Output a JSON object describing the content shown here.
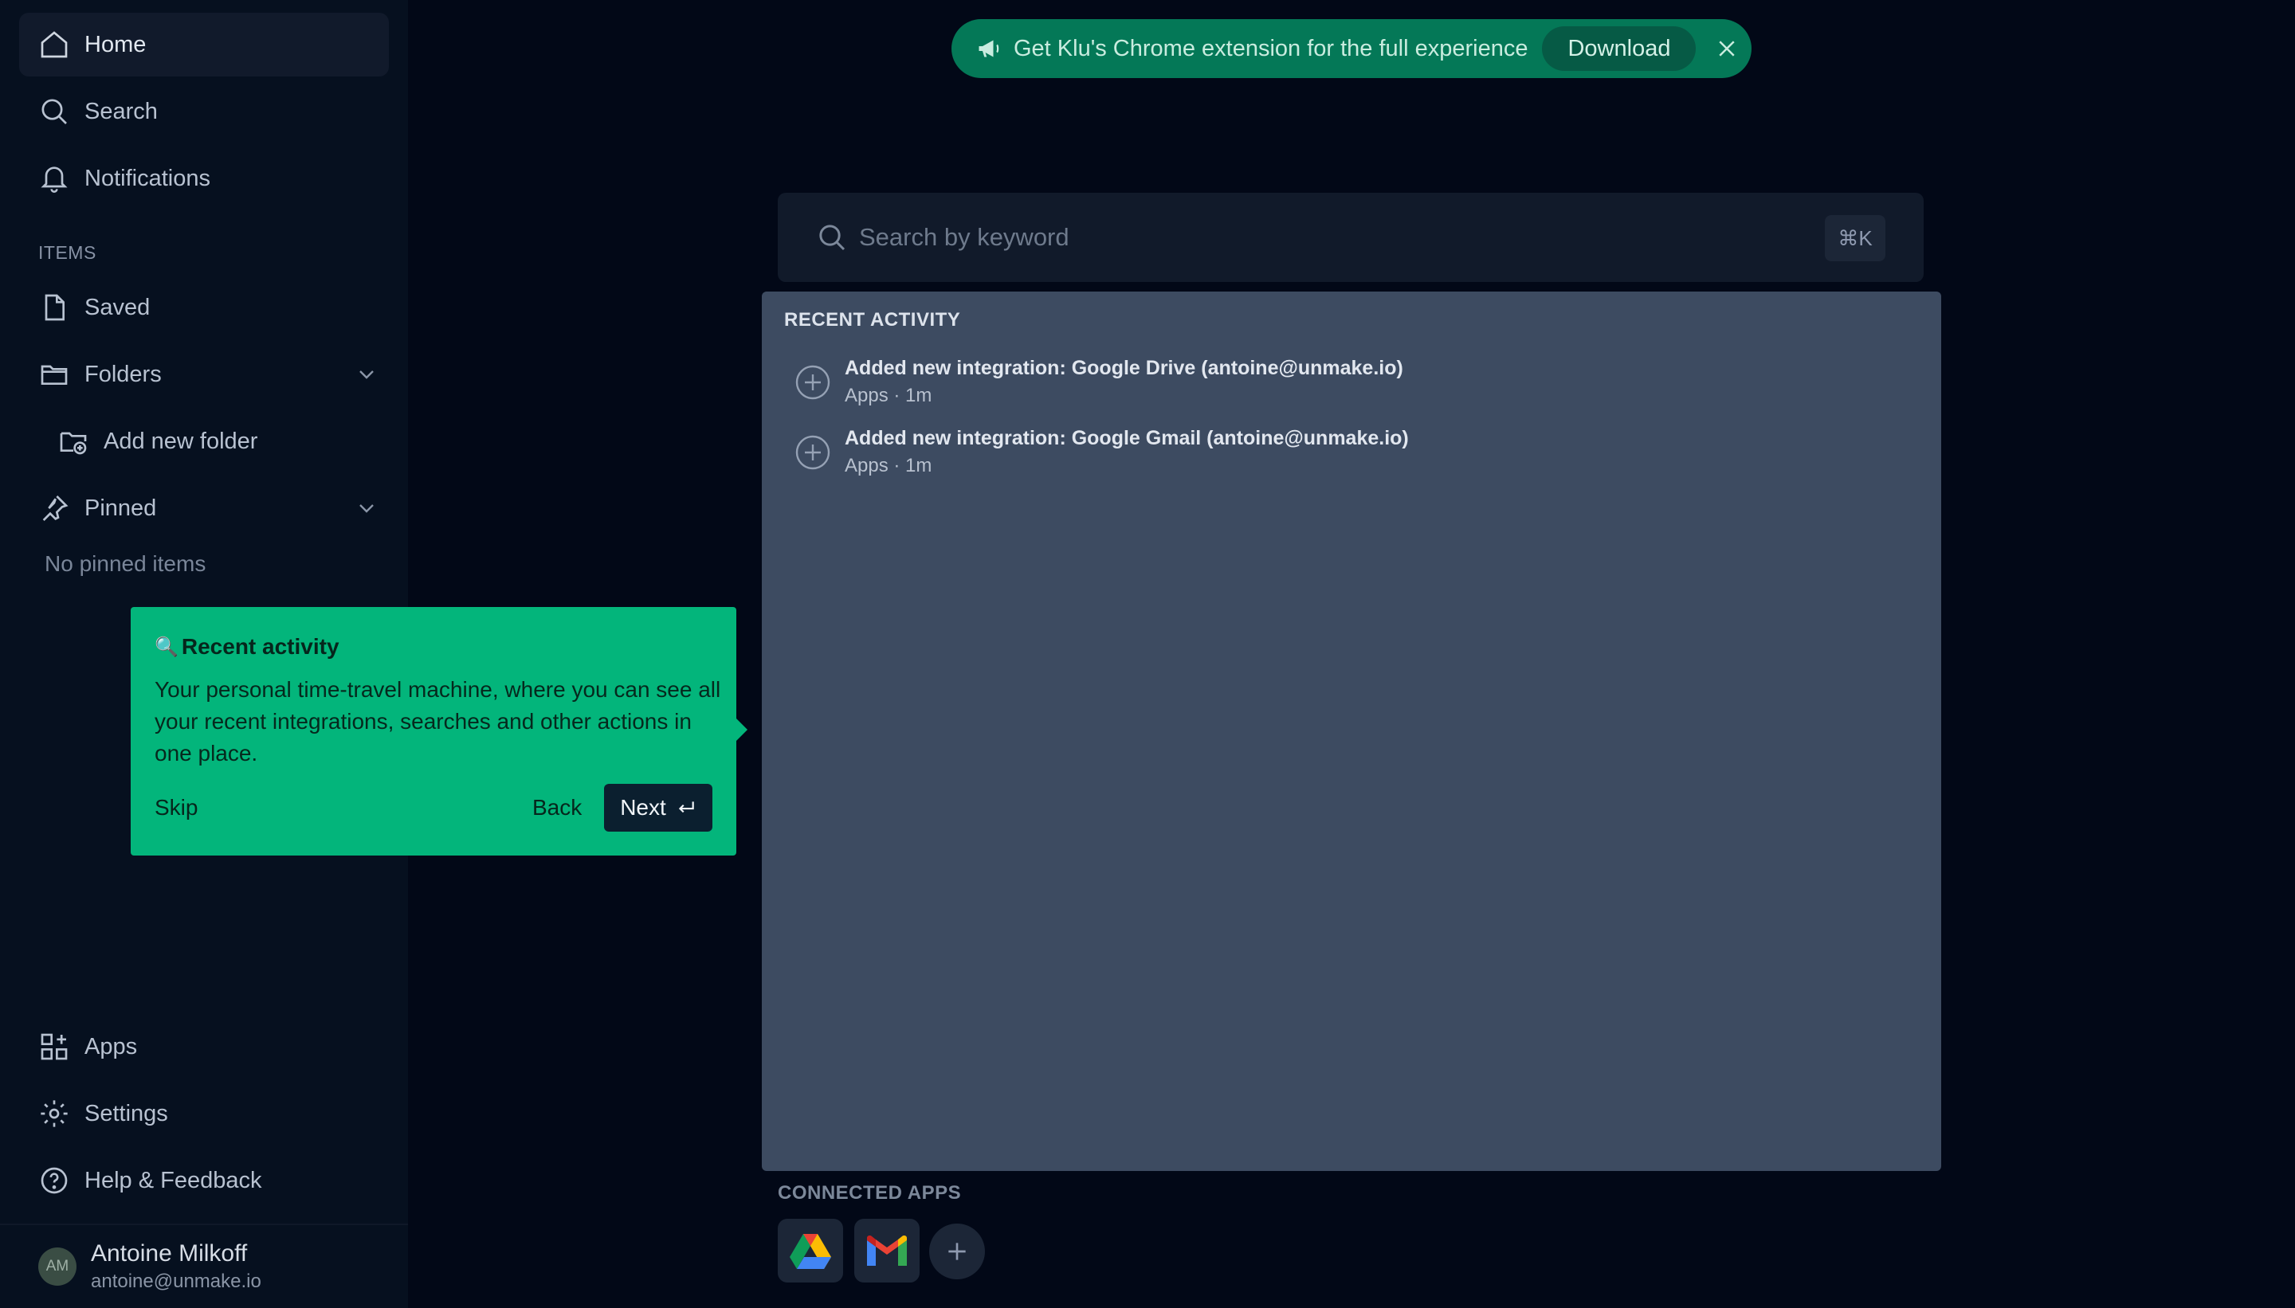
{
  "sidebar": {
    "nav": [
      {
        "label": "Home",
        "icon": "home-icon"
      },
      {
        "label": "Search",
        "icon": "search-icon"
      },
      {
        "label": "Notifications",
        "icon": "bell-icon"
      }
    ],
    "items_section": "ITEMS",
    "saved": "Saved",
    "folders": "Folders",
    "add_folder": "Add new folder",
    "pinned": "Pinned",
    "no_pinned": "No pinned items",
    "bottom": [
      {
        "label": "Apps",
        "icon": "apps-grid-icon"
      },
      {
        "label": "Settings",
        "icon": "gear-icon"
      },
      {
        "label": "Help & Feedback",
        "icon": "help-circle-icon"
      }
    ]
  },
  "user": {
    "initials": "AM",
    "name": "Antoine Milkoff",
    "email": "antoine@unmake.io"
  },
  "banner": {
    "text": "Get Klu's Chrome extension for the full experience",
    "download": "Download"
  },
  "search": {
    "placeholder": "Search by keyword",
    "shortcut": "⌘K"
  },
  "recent": {
    "title": "RECENT ACTIVITY",
    "items": [
      {
        "title": "Added new integration: Google Drive (antoine@unmake.io)",
        "meta": "Apps · 1m"
      },
      {
        "title": "Added new integration: Google Gmail (antoine@unmake.io)",
        "meta": "Apps · 1m"
      }
    ]
  },
  "connected": {
    "title": "CONNECTED APPS",
    "apps": [
      "google-drive-icon",
      "gmail-icon"
    ]
  },
  "tour": {
    "emoji": "🔍",
    "title": "Recent activity",
    "body": "Your personal time-travel machine, where you can see all your recent integrations, searches and other actions in one place.",
    "skip": "Skip",
    "back": "Back",
    "next": "Next"
  },
  "colors": {
    "background": "#020817",
    "accent": "#03b57b",
    "banner": "#047857",
    "panel": "#3d4b61"
  }
}
